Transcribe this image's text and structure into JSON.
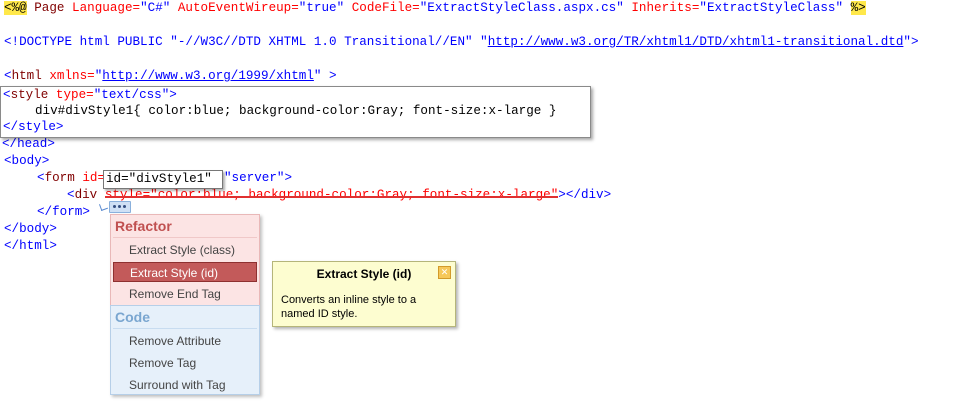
{
  "code": {
    "directive": {
      "open": "<%@",
      "page": "Page",
      "lang_attr": "Language=",
      "lang_val": "\"C#\"",
      "aew_attr": "AutoEventWireup=",
      "aew_val": "\"true\"",
      "cf_attr": "CodeFile=",
      "cf_val": "\"ExtractStyleClass.aspx.cs\"",
      "inh_attr": "Inherits=",
      "inh_val": "\"ExtractStyleClass\"",
      "close": "%>"
    },
    "doctype": {
      "open": "<!DOCTYPE html PUBLIC",
      "fpi": "\"-//W3C//DTD XHTML 1.0 Transitional//EN\"",
      "q": "\"",
      "url": "http://www.w3.org/TR/xhtml1/DTD/xhtml1-transitional.dtd",
      "end": ">"
    },
    "html_line": {
      "lt": "<",
      "tag": "html",
      "attr": "xmlns=",
      "q": "\"",
      "url": "http://www.w3.org/1999/xhtml",
      "end": " >"
    },
    "head_close": "</head>",
    "body_open": "<body>",
    "form_line": {
      "lt": "<",
      "tag": "form",
      "rest": "id=",
      "runat": "\"server\">"
    },
    "div_line": {
      "lt": "<",
      "tag": "div",
      "style_text": "style=\"color:blue; background-color:Gray; font-size:x-large\"",
      "end": "></div>"
    },
    "form_close": "</form>",
    "body_close": "</body>",
    "html_close": "</html>"
  },
  "preview": {
    "line1_lt": "<",
    "line1_tag": "style",
    "line1_attr": "type=",
    "line1_val": "\"text/css\"",
    "line1_end": ">",
    "line2": "div#divStyle1{ color:blue; background-color:Gray; font-size:x-large }",
    "line3": "</style>"
  },
  "id_tooltip": "id=\"divStyle1\"",
  "menu": {
    "refactor_header": "Refactor",
    "refactor_items": [
      "Extract Style (class)",
      "Extract Style (id)",
      "Remove End Tag"
    ],
    "code_header": "Code",
    "code_items": [
      "Remove Attribute",
      "Remove Tag",
      "Surround with Tag"
    ]
  },
  "tooltip": {
    "title": "Extract Style (id)",
    "body": "Converts an inline style to a named ID style."
  },
  "colors": {
    "keyword": "#0000ff",
    "tag": "#800000",
    "attribute": "#ff0000",
    "selected_item": "#c35a5a"
  },
  "icons": {
    "smart_tag": "smart-tag-icon",
    "tooltip_close": "close-icon"
  }
}
